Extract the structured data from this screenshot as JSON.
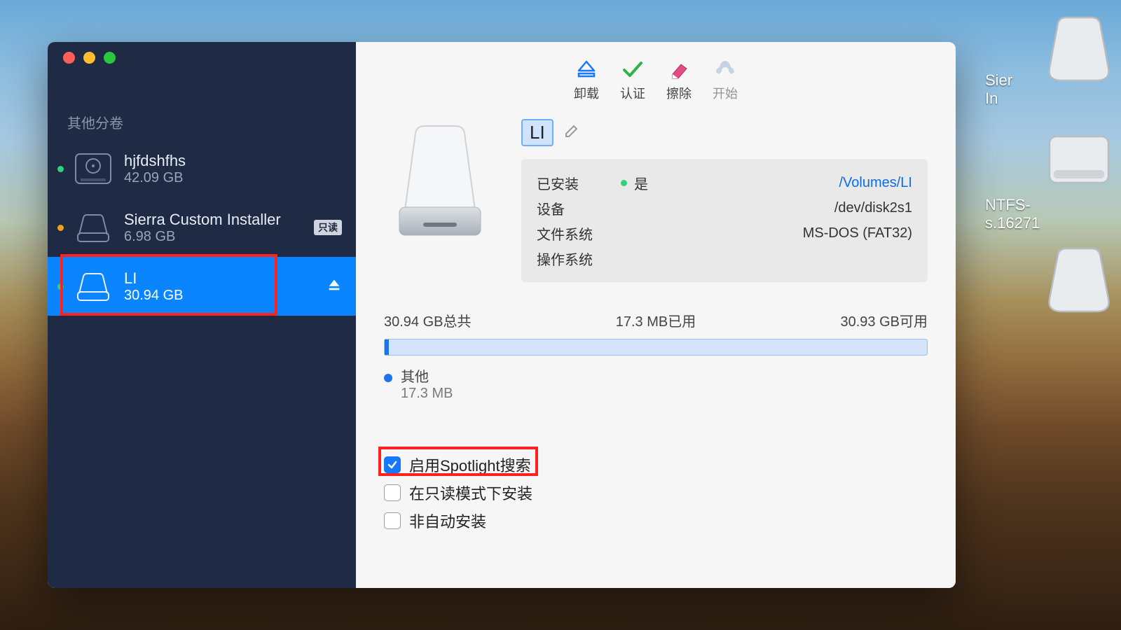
{
  "sidebar": {
    "section_label": "其他分卷",
    "items": [
      {
        "name": "hjfdshfhs",
        "size": "42.09 GB",
        "status": "green"
      },
      {
        "name": "Sierra Custom Installer",
        "size": "6.98 GB",
        "status": "orange",
        "badge": "只读"
      },
      {
        "name": "LI",
        "size": "30.94 GB",
        "status": "green",
        "selected": true,
        "ejectable": true
      }
    ]
  },
  "toolbar": {
    "unmount": "卸载",
    "verify": "认证",
    "erase": "擦除",
    "start": "开始"
  },
  "detail": {
    "volume_name": "LI",
    "mounted_label": "已安装",
    "mounted_yes": "是",
    "mount_path": "/Volumes/LI",
    "device_label": "设备",
    "device_value": "/dev/disk2s1",
    "fs_label": "文件系统",
    "fs_value": "MS-DOS (FAT32)",
    "os_label": "操作系统",
    "os_value": ""
  },
  "usage": {
    "total": "30.94 GB总共",
    "used": "17.3 MB已用",
    "free": "30.93 GB可用",
    "legend_name": "其他",
    "legend_size": "17.3 MB"
  },
  "options": {
    "spotlight": "启用Spotlight搜索",
    "readonly": "在只读模式下安装",
    "noauto": "非自动安装"
  },
  "desktop": {
    "label1_line1": "Sier",
    "label1_line2": "In",
    "label2_line1": "NTFS-",
    "label2_line2": "s.16271"
  }
}
